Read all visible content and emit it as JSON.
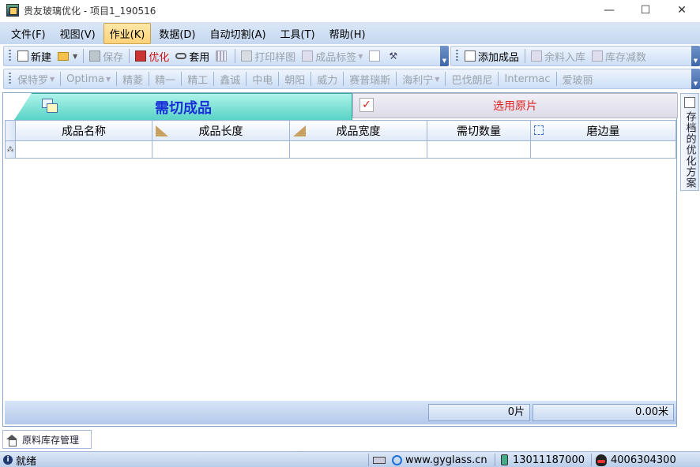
{
  "window": {
    "title": "贵友玻璃优化 - 项目1_190516",
    "controls": [
      "—",
      "☐",
      "✕"
    ]
  },
  "menu": [
    {
      "label": "文件(F)"
    },
    {
      "label": "视图(V)"
    },
    {
      "label": "作业(K)",
      "active": true
    },
    {
      "label": "数据(D)"
    },
    {
      "label": "自动切割(A)"
    },
    {
      "label": "工具(T)"
    },
    {
      "label": "帮助(H)"
    }
  ],
  "toolbar1": {
    "new": "新建",
    "save": "保存",
    "optimize": "优化",
    "apply": "套用",
    "print_sample": "打印样图",
    "product_label": "成品标签",
    "add_product": "添加成品",
    "remnant_in": "余料入库",
    "stock_reduce": "库存减数"
  },
  "toolbar2": {
    "machines": [
      "保特罗",
      "Optima",
      "精菱",
      "精一",
      "精工",
      "鑫诚",
      "中电",
      "朝阳",
      "威力",
      "赛普瑞斯",
      "海利宁",
      "巴伐朗尼",
      "Intermac",
      "爱玻丽"
    ]
  },
  "tabs": {
    "active": "需切成品",
    "inactive": "选用原片"
  },
  "grid": {
    "columns": [
      "成品名称",
      "成品长度",
      "成品宽度",
      "需切数量",
      "磨边量"
    ],
    "new_row_marker": "⁂",
    "totals": {
      "count": "0片",
      "length": "0.00米"
    }
  },
  "side_panel": {
    "label": "存档的优化方案"
  },
  "bottom_tab": {
    "label": "原料库存管理"
  },
  "status": {
    "state": "就绪",
    "website": "www.gyglass.cn",
    "phone": "13011187000",
    "qq": "4006304300"
  },
  "colors": {
    "active_tab": "#58d3c6",
    "active_tab_text": "#1a2fd6",
    "inactive_tab_text": "#e02020",
    "menu_active": "#ffd27a",
    "chrome_blue": "#c5d8f1"
  }
}
